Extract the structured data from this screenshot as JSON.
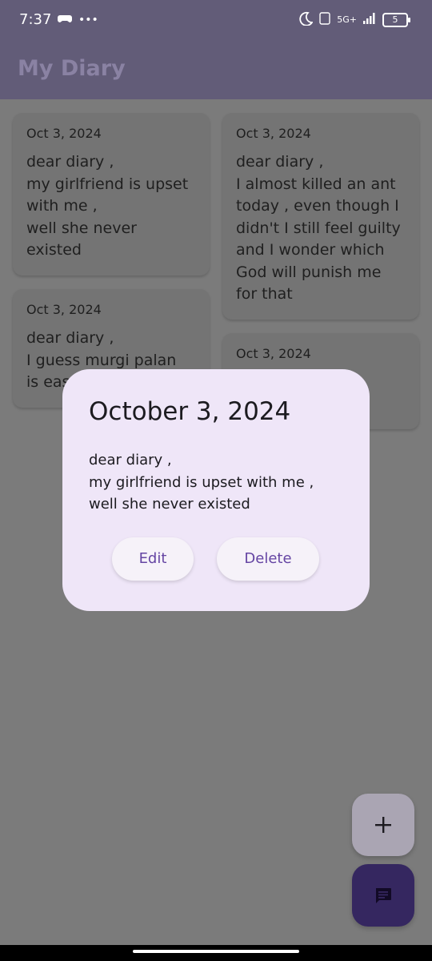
{
  "status_bar": {
    "time": "7:37",
    "network_label": "5G+",
    "battery_level": "5"
  },
  "app_bar": {
    "title": "My Diary"
  },
  "entries": [
    {
      "date": "Oct 3, 2024",
      "body": "dear diary ,\nmy girlfriend is upset\nwith me ,\nwell she never\nexisted"
    },
    {
      "date": "Oct 3, 2024",
      "body": "dear diary ,\nI almost killed an ant\ntoday , even though I\ndidn't I still feel guilty\nand I wonder which\nGod will punish me\nfor that"
    },
    {
      "date": "Oct 3, 2024",
      "body": "dear diary ,\nI guess murgi palan\nis eas"
    },
    {
      "date": "Oct 3, 2024",
      "body": ""
    }
  ],
  "dialog": {
    "title": "October 3, 2024",
    "body": "dear diary ,\nmy girlfriend is upset with me ,\nwell she never existed",
    "edit_label": "Edit",
    "delete_label": "Delete"
  },
  "colors": {
    "accent": "#6545a3",
    "dialog_background": "#efe6f8",
    "chat_fab": "#352760"
  }
}
